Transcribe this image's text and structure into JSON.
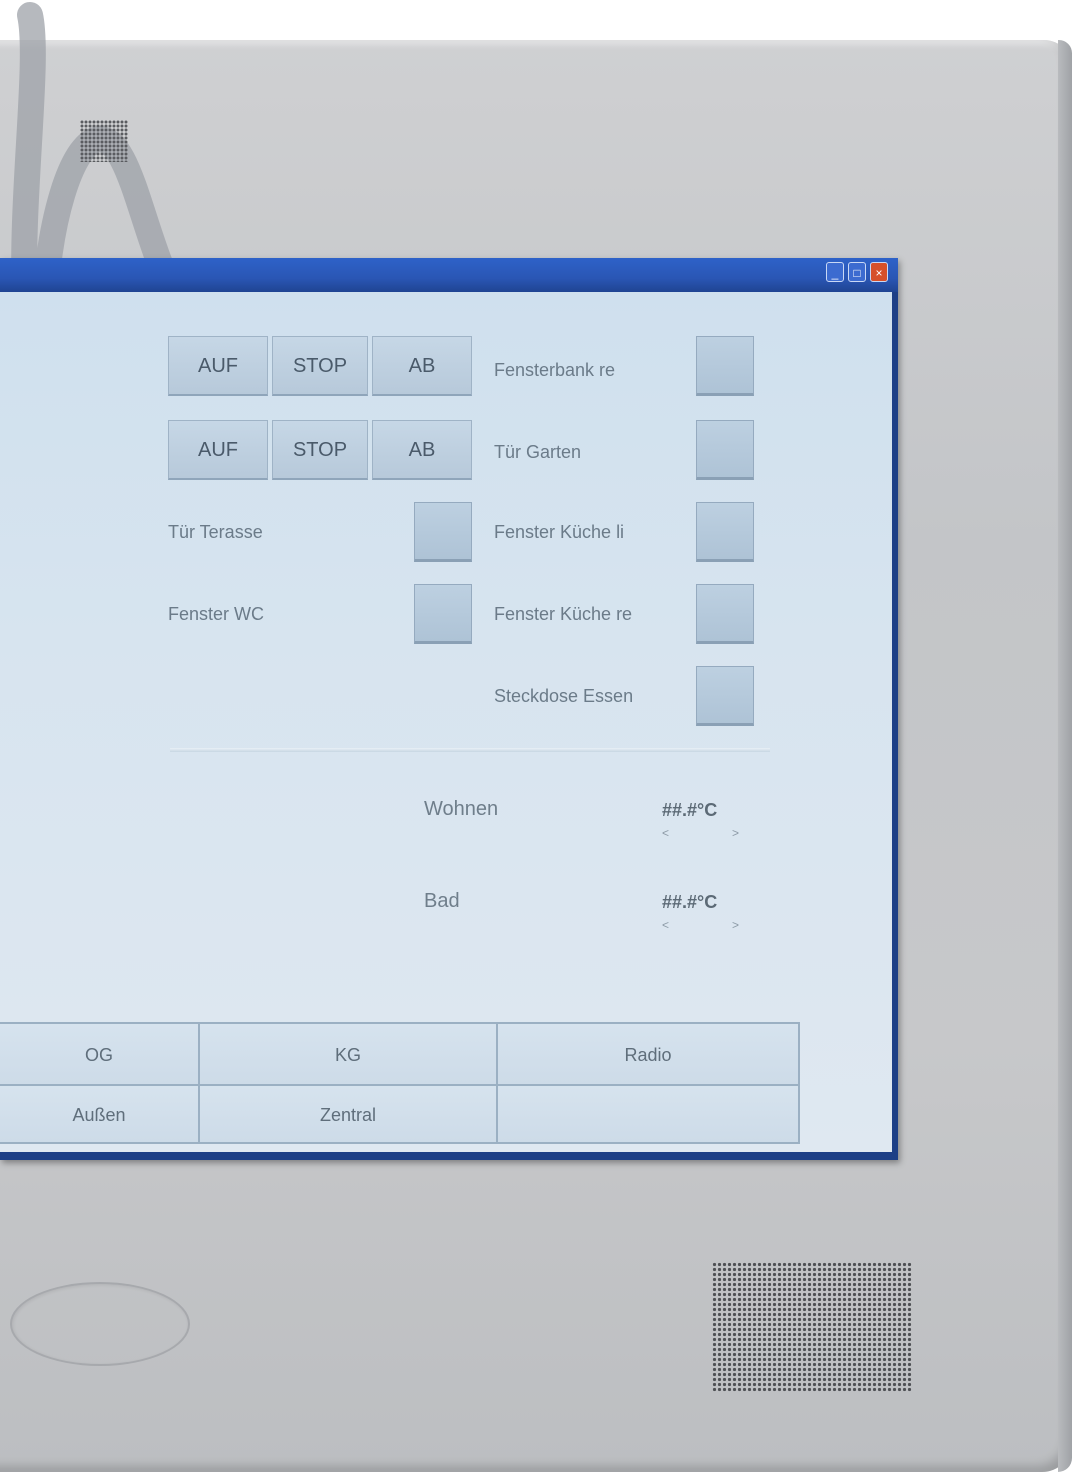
{
  "window": {
    "buttons": {
      "minimize": "_",
      "maximize": "□",
      "close": "×"
    }
  },
  "shutters": [
    {
      "up": "AUF",
      "stop": "STOP",
      "down": "AB",
      "label": "Fensterbank re"
    },
    {
      "up": "AUF",
      "stop": "STOP",
      "down": "AB",
      "label": "Tür Garten"
    }
  ],
  "switches_left": [
    {
      "label": "Tür Terasse"
    },
    {
      "label": "Fenster WC"
    }
  ],
  "switches_right": [
    {
      "label": "Fenster Küche li"
    },
    {
      "label": "Fenster Küche re"
    },
    {
      "label": "Steckdose Essen"
    }
  ],
  "temperatures": [
    {
      "room": "Wohnen",
      "value": "##.#°C",
      "min": "<",
      "max": ">"
    },
    {
      "room": "Bad",
      "value": "##.#°C",
      "min": "<",
      "max": ">"
    }
  ],
  "nav": {
    "row1": [
      "OG",
      "KG",
      "Radio"
    ],
    "row2": [
      "Außen",
      "Zentral",
      ""
    ]
  },
  "colors": {
    "titlebar": "#2a56b4",
    "client_bg": "#d7e4ef",
    "bezel": "#c5c7ca"
  },
  "icons": [
    "speaker-grille-icon",
    "home-button-icon",
    "brand-logo-icon"
  ]
}
